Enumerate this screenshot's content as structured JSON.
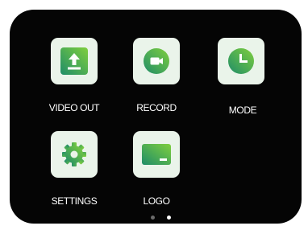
{
  "menu": {
    "items": [
      {
        "label": "VIDEO OUT",
        "icon": "upload-icon"
      },
      {
        "label": "RECORD",
        "icon": "record-camera-icon"
      },
      {
        "label": "MODE",
        "icon": "clock-icon"
      },
      {
        "label": "SETTINGS",
        "icon": "gear-icon"
      },
      {
        "label": "LOGO",
        "icon": "logo-screen-icon"
      }
    ]
  },
  "pagination": {
    "page_count": 2,
    "active_page": 2
  },
  "colors": {
    "screen_bg": "#050505",
    "tile_bg": "#eaf4ea",
    "icon_gradient_start": "#1f8d68",
    "icon_gradient_end": "#7fcf3e",
    "dot_active": "#ffffff",
    "dot_inactive": "#6b6b6b"
  }
}
